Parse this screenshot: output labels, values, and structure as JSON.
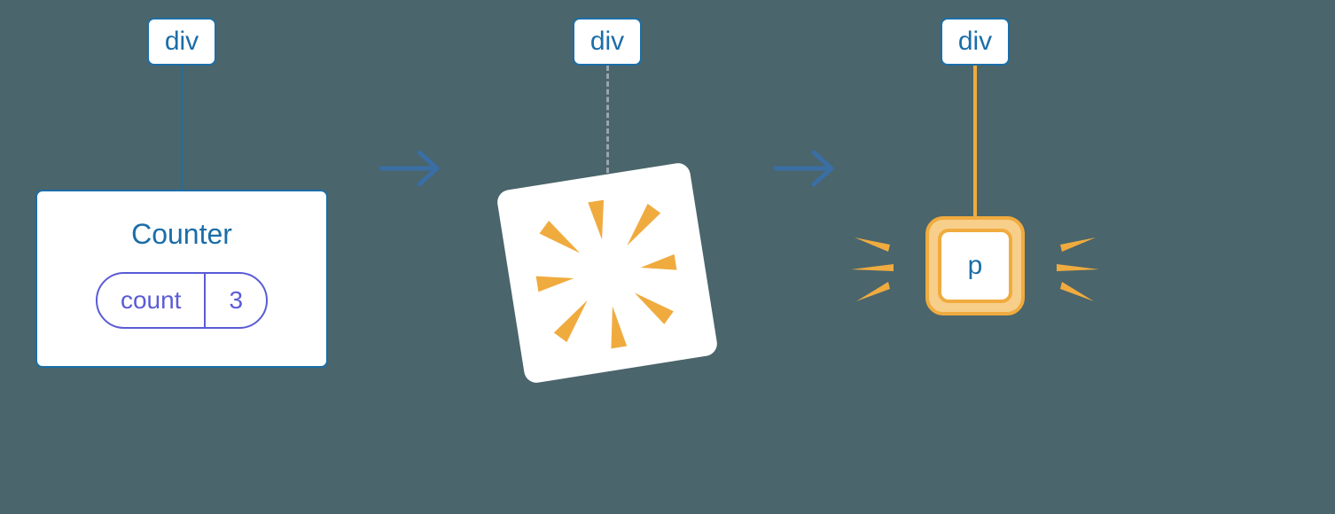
{
  "stage1": {
    "root_label": "div",
    "component_label": "Counter",
    "state_key": "count",
    "state_value": "3"
  },
  "stage2": {
    "root_label": "div"
  },
  "stage3": {
    "root_label": "div",
    "new_node_label": "p"
  },
  "colors": {
    "background": "#4a656b",
    "node_border": "#1b6ea8",
    "state_border": "#5b5bd6",
    "highlight": "#f0ab3f",
    "arrow": "#3a6ea5"
  },
  "chart_data": {
    "type": "diagram",
    "description": "React component tree transition: a div with a Counter child (state count=3) is removed and replaced with a new p element under the same div.",
    "stages": [
      {
        "id": 1,
        "tree": {
          "root": "div",
          "children": [
            {
              "component": "Counter",
              "state": {
                "count": 3
              }
            }
          ]
        }
      },
      {
        "id": 2,
        "tree": {
          "root": "div",
          "children": [],
          "note": "child unmounting / destroyed"
        }
      },
      {
        "id": 3,
        "tree": {
          "root": "div",
          "children": [
            {
              "element": "p",
              "new": true
            }
          ]
        }
      }
    ],
    "transitions": [
      "1→2",
      "2→3"
    ]
  }
}
